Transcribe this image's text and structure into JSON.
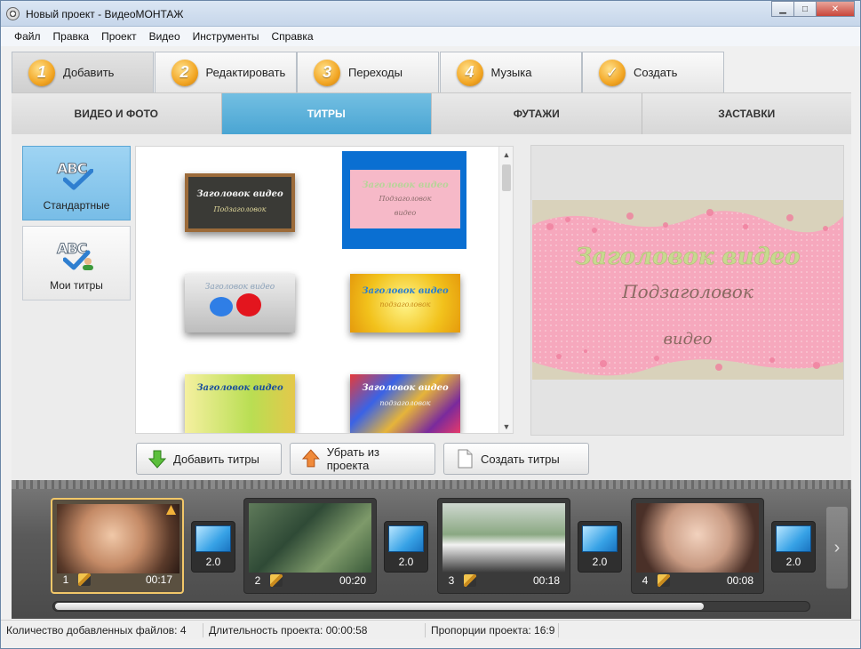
{
  "window": {
    "title": "Новый проект - ВидеоМОНТАЖ"
  },
  "menu": [
    "Файл",
    "Правка",
    "Проект",
    "Видео",
    "Инструменты",
    "Справка"
  ],
  "steps": [
    {
      "num": "1",
      "label": "Добавить",
      "active": true
    },
    {
      "num": "2",
      "label": "Редактировать"
    },
    {
      "num": "3",
      "label": "Переходы"
    },
    {
      "num": "4",
      "label": "Музыка"
    },
    {
      "num": "✓",
      "label": "Создать"
    }
  ],
  "subtabs": [
    "ВИДЕО И ФОТО",
    "ТИТРЫ",
    "ФУТАЖИ",
    "ЗАСТАВКИ"
  ],
  "active_subtab": "ТИТРЫ",
  "categories": [
    {
      "label": "Стандартные",
      "icon": "abc-check-icon",
      "active": true
    },
    {
      "label": "Мои титры",
      "icon": "abc-user-icon"
    }
  ],
  "thumbs": {
    "t1": {
      "title": "Заголовок видео",
      "subtitle": "Подзаголовок"
    },
    "t2": {
      "title": "Заголовок видео",
      "subtitle": "Подзаголовок",
      "extra": "видео"
    },
    "t3": {
      "title": "Заголовок видео"
    },
    "t4": {
      "title": "Заголовок видео",
      "subtitle": "подзаголовок"
    },
    "t5": {
      "title": "Заголовок видео"
    },
    "t6": {
      "title": "Заголовок видео",
      "subtitle": "подзаголовок"
    }
  },
  "preview": {
    "title": "Заголовок видео",
    "subtitle": "Подзаголовок",
    "line3": "видео"
  },
  "actions": {
    "add": "Добавить титры",
    "remove": "Убрать из проекта",
    "create": "Создать титры"
  },
  "timeline": {
    "clips": [
      {
        "num": "1",
        "dur": "00:17"
      },
      {
        "num": "2",
        "dur": "00:20"
      },
      {
        "num": "3",
        "dur": "00:18"
      },
      {
        "num": "4",
        "dur": "00:08"
      }
    ],
    "transitions": [
      "2.0",
      "2.0",
      "2.0",
      "2.0"
    ]
  },
  "status": {
    "files": "Количество добавленных файлов: 4",
    "duration": "Длительность проекта:  00:00:58",
    "aspect": "Пропорции проекта:  16:9"
  },
  "colors": {
    "accent": "#4aa5d3",
    "selection": "#0a6fd2",
    "step_badge": "#f2a624"
  }
}
